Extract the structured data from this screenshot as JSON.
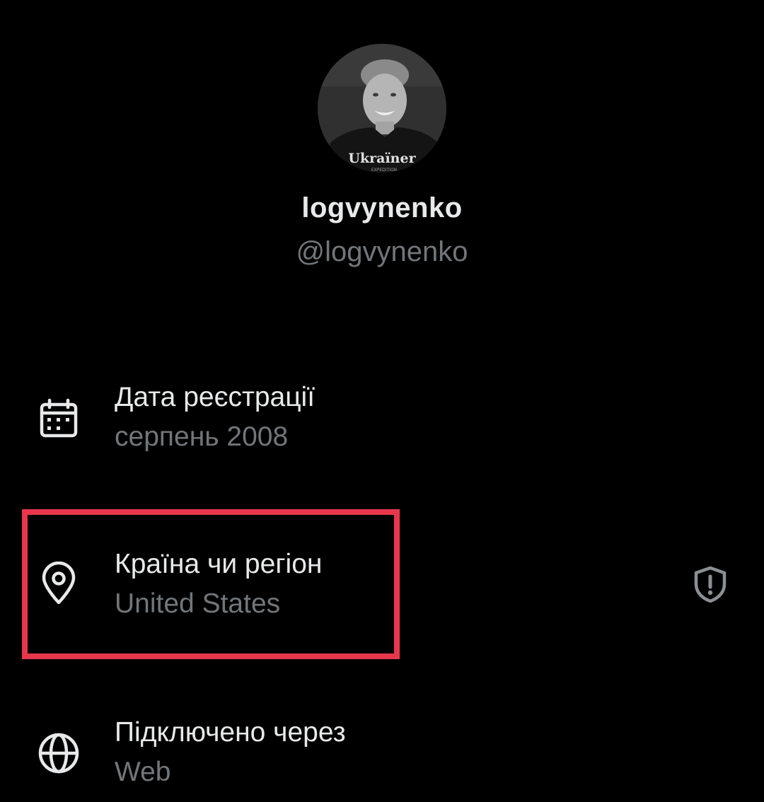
{
  "profile": {
    "avatar_shirt_text": "Ukraïner",
    "avatar_shirt_subtext": "EXPEDITION",
    "display_name": "logvynenko",
    "handle": "@logvynenko"
  },
  "details": {
    "joined": {
      "title": "Дата реєстрації",
      "value": "серпень 2008",
      "icon": "calendar-icon"
    },
    "country": {
      "title": "Країна чи регіон",
      "value": "United States",
      "icon": "location-pin-icon",
      "badge_icon": "shield-alert-icon"
    },
    "connected": {
      "title": "Підключено через",
      "value": "Web",
      "icon": "globe-icon"
    }
  },
  "colors": {
    "background": "#000000",
    "primary_text": "#e7e9ea",
    "secondary_text": "#71767b",
    "highlight": "#e8374c"
  }
}
